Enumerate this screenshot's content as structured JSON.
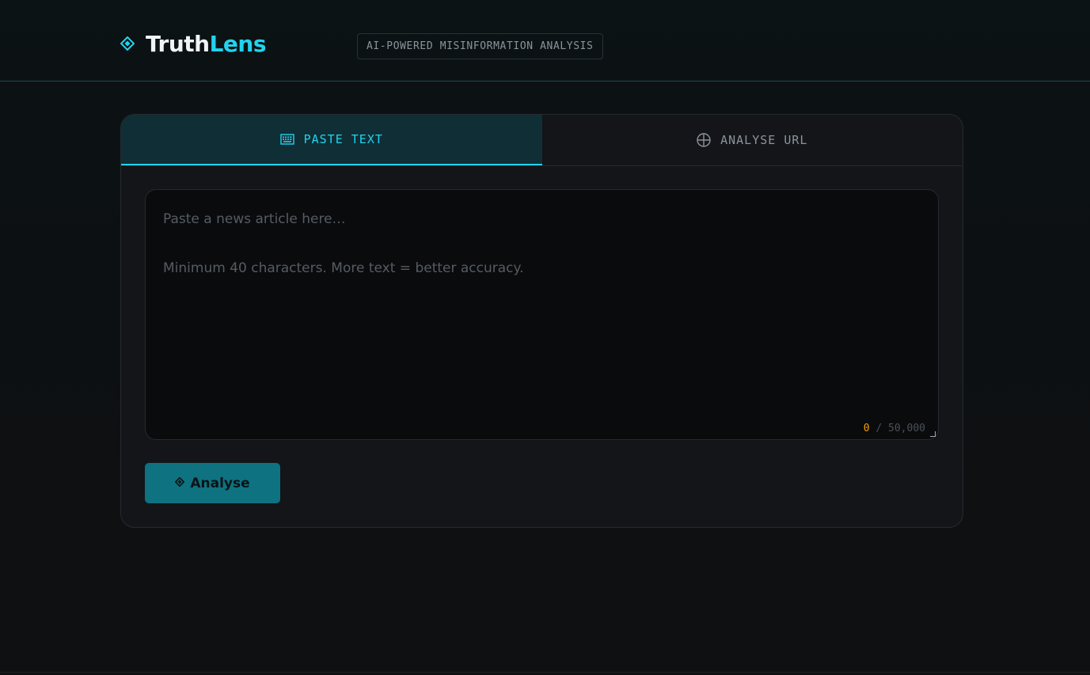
{
  "header": {
    "logo_main": "Truth",
    "logo_accent": "Lens",
    "tagline": "AI-POWERED MISINFORMATION ANALYSIS"
  },
  "tabs": [
    {
      "label": "PASTE TEXT",
      "icon": "keyboard-icon",
      "active": true
    },
    {
      "label": "ANALYSE URL",
      "icon": "globe-icon",
      "active": false
    }
  ],
  "input": {
    "value": "",
    "placeholder": "Paste a news article here…\n\nMinimum 40 characters. More text = better accuracy.",
    "count": "0",
    "max": "/ 50,000"
  },
  "actions": {
    "analyse_label": "Analyse",
    "analyse_icon": "diamond-icon"
  },
  "colors": {
    "accent": "#22d3ee",
    "button": "#0e7281",
    "counter": "#f59e0b",
    "background": "#0d1113"
  }
}
